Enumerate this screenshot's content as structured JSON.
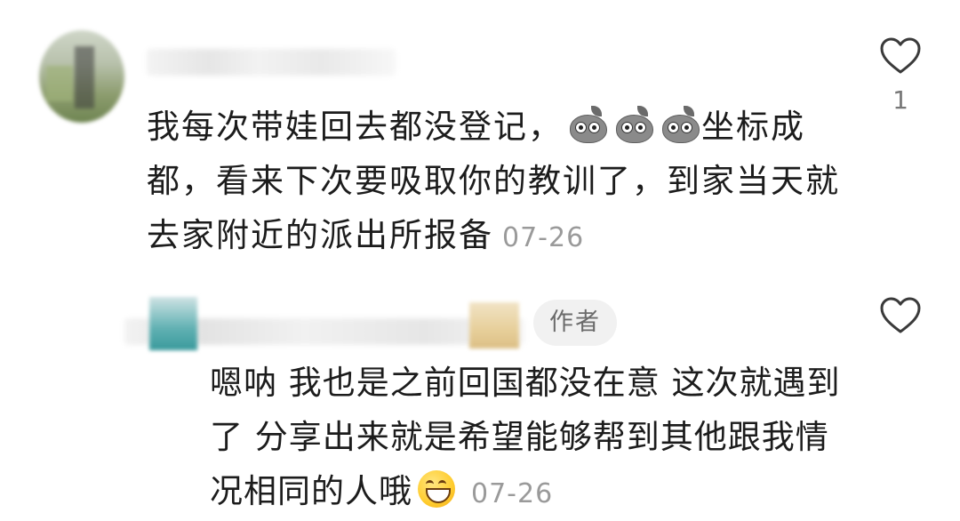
{
  "comment": {
    "text_before_emoji": "我每次带娃回去都没登记，",
    "emoji": [
      "rock-face-emoji",
      "rock-face-emoji",
      "rock-face-emoji"
    ],
    "text_after_emoji": "坐标成都，看来下次要吸取你的教训了，到家当天就去家附近的派出所报备",
    "date": "07-26",
    "like_count": "1"
  },
  "reply": {
    "author_badge": "作者",
    "text": "嗯呐 我也是之前回国都没在意 这次就遇到了 分享出来就是希望能够帮到其他跟我情况相同的人哦",
    "emoji": "grinning-face-emoji",
    "date": "07-26"
  }
}
